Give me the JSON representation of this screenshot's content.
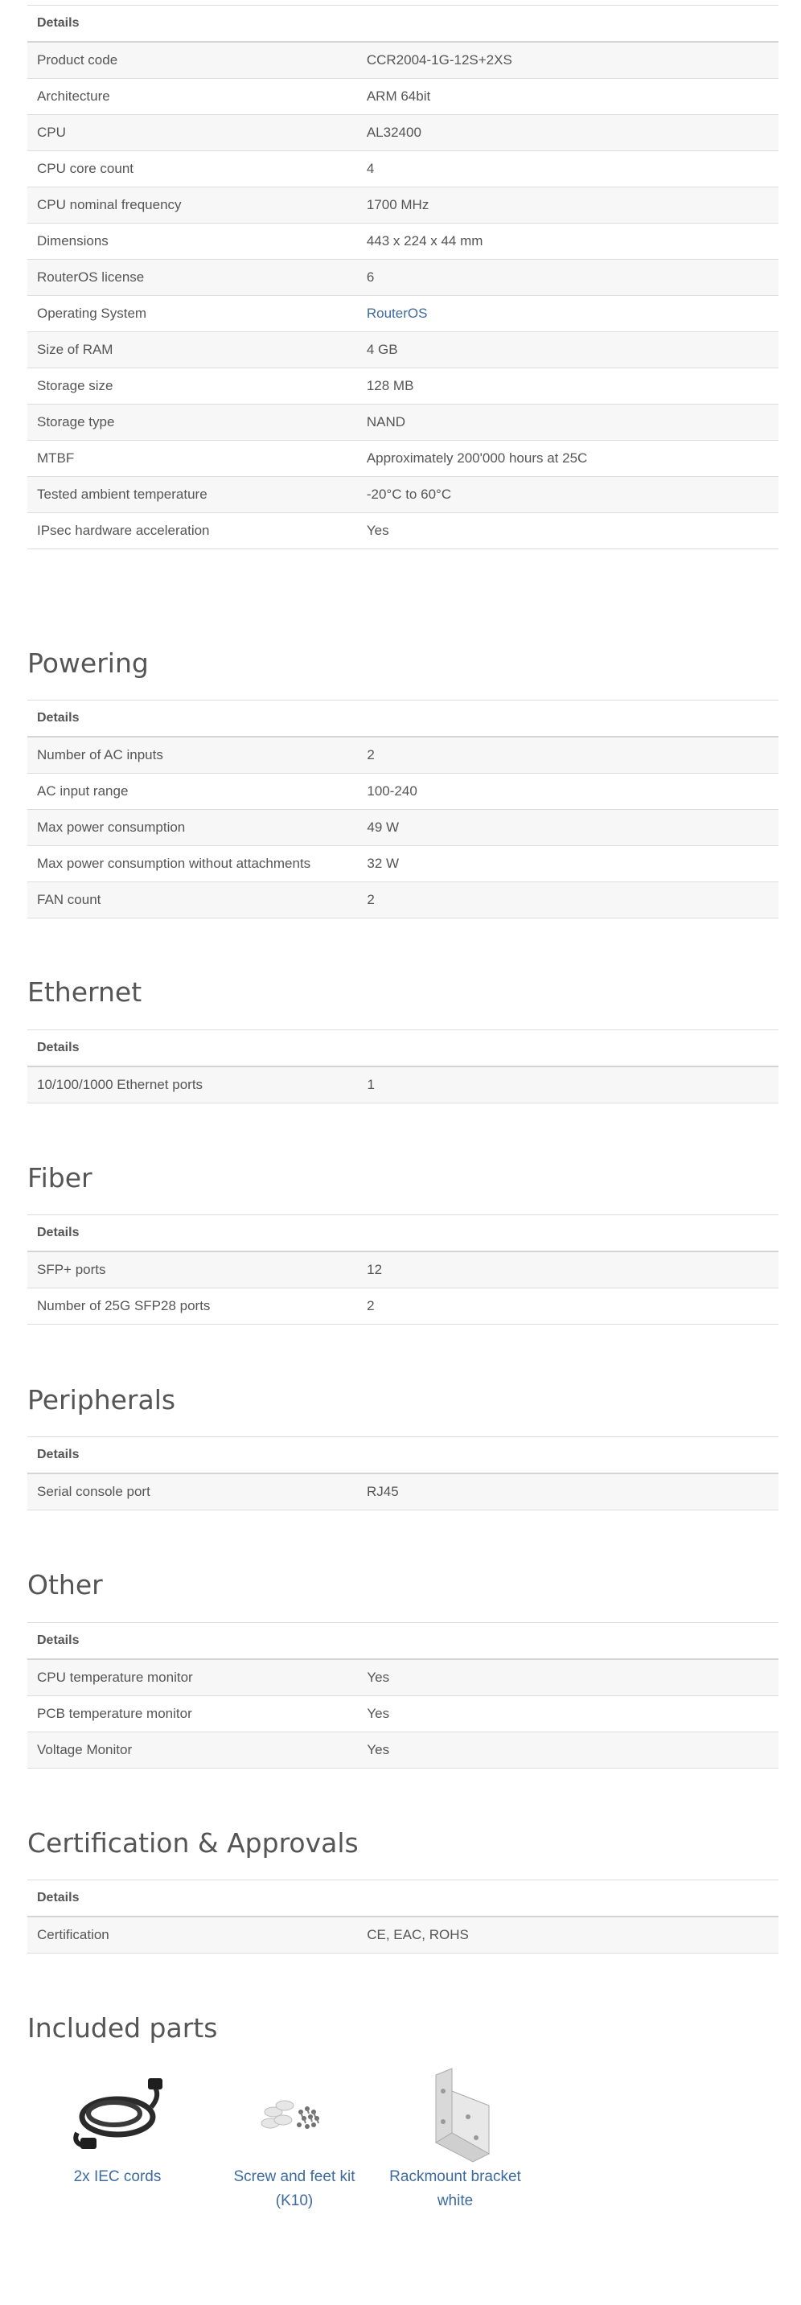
{
  "general": {
    "header": "Details",
    "rows": [
      {
        "name": "Product code",
        "value": "CCR2004-1G-12S+2XS"
      },
      {
        "name": "Architecture",
        "value": "ARM 64bit"
      },
      {
        "name": "CPU",
        "value": "AL32400"
      },
      {
        "name": "CPU core count",
        "value": "4"
      },
      {
        "name": "CPU nominal frequency",
        "value": "1700 MHz"
      },
      {
        "name": "Dimensions",
        "value": "443 x 224 x 44 mm"
      },
      {
        "name": "RouterOS license",
        "value": "6"
      },
      {
        "name": "Operating System",
        "value": "RouterOS"
      },
      {
        "name": "Size of RAM",
        "value": "4 GB"
      },
      {
        "name": "Storage size",
        "value": "128 MB"
      },
      {
        "name": "Storage type",
        "value": "NAND"
      },
      {
        "name": "MTBF",
        "value": "Approximately 200'000 hours at 25C"
      },
      {
        "name": "Tested ambient temperature",
        "value": "-20°C to 60°C"
      },
      {
        "name": "IPsec hardware acceleration",
        "value": "Yes"
      }
    ]
  },
  "powering": {
    "title": "Powering",
    "header": "Details",
    "rows": [
      {
        "name": "Number of AC inputs",
        "value": "2"
      },
      {
        "name": "AC input range",
        "value": "100-240"
      },
      {
        "name": "Max power consumption",
        "value": "49 W"
      },
      {
        "name": "Max power consumption without attachments",
        "value": "32 W"
      },
      {
        "name": "FAN count",
        "value": "2"
      }
    ]
  },
  "ethernet": {
    "title": "Ethernet",
    "header": "Details",
    "rows": [
      {
        "name": "10/100/1000 Ethernet ports",
        "value": "1"
      }
    ]
  },
  "fiber": {
    "title": "Fiber",
    "header": "Details",
    "rows": [
      {
        "name": "SFP+ ports",
        "value": "12"
      },
      {
        "name": "Number of 25G SFP28 ports",
        "value": "2"
      }
    ]
  },
  "peripherals": {
    "title": "Peripherals",
    "header": "Details",
    "rows": [
      {
        "name": "Serial console port",
        "value": "RJ45"
      }
    ]
  },
  "other": {
    "title": "Other",
    "header": "Details",
    "rows": [
      {
        "name": "CPU temperature monitor",
        "value": "Yes"
      },
      {
        "name": "PCB temperature monitor",
        "value": "Yes"
      },
      {
        "name": "Voltage Monitor",
        "value": "Yes"
      }
    ]
  },
  "certification": {
    "title": "Certification & Approvals",
    "header": "Details",
    "rows": [
      {
        "name": "Certification",
        "value": "CE, EAC, ROHS"
      }
    ]
  },
  "included": {
    "title": "Included parts",
    "items": [
      {
        "label_line1": "2x IEC cords",
        "label_line2": "",
        "icon": "power-cord-icon"
      },
      {
        "label_line1": "Screw and feet kit",
        "label_line2": "(K10)",
        "icon": "screw-kit-icon"
      },
      {
        "label_line1": "Rackmount bracket",
        "label_line2": "white",
        "icon": "bracket-icon"
      }
    ]
  },
  "colors": {
    "link": "#3d6aa0",
    "stripe": "#f7f7f7",
    "text": "#555555"
  }
}
